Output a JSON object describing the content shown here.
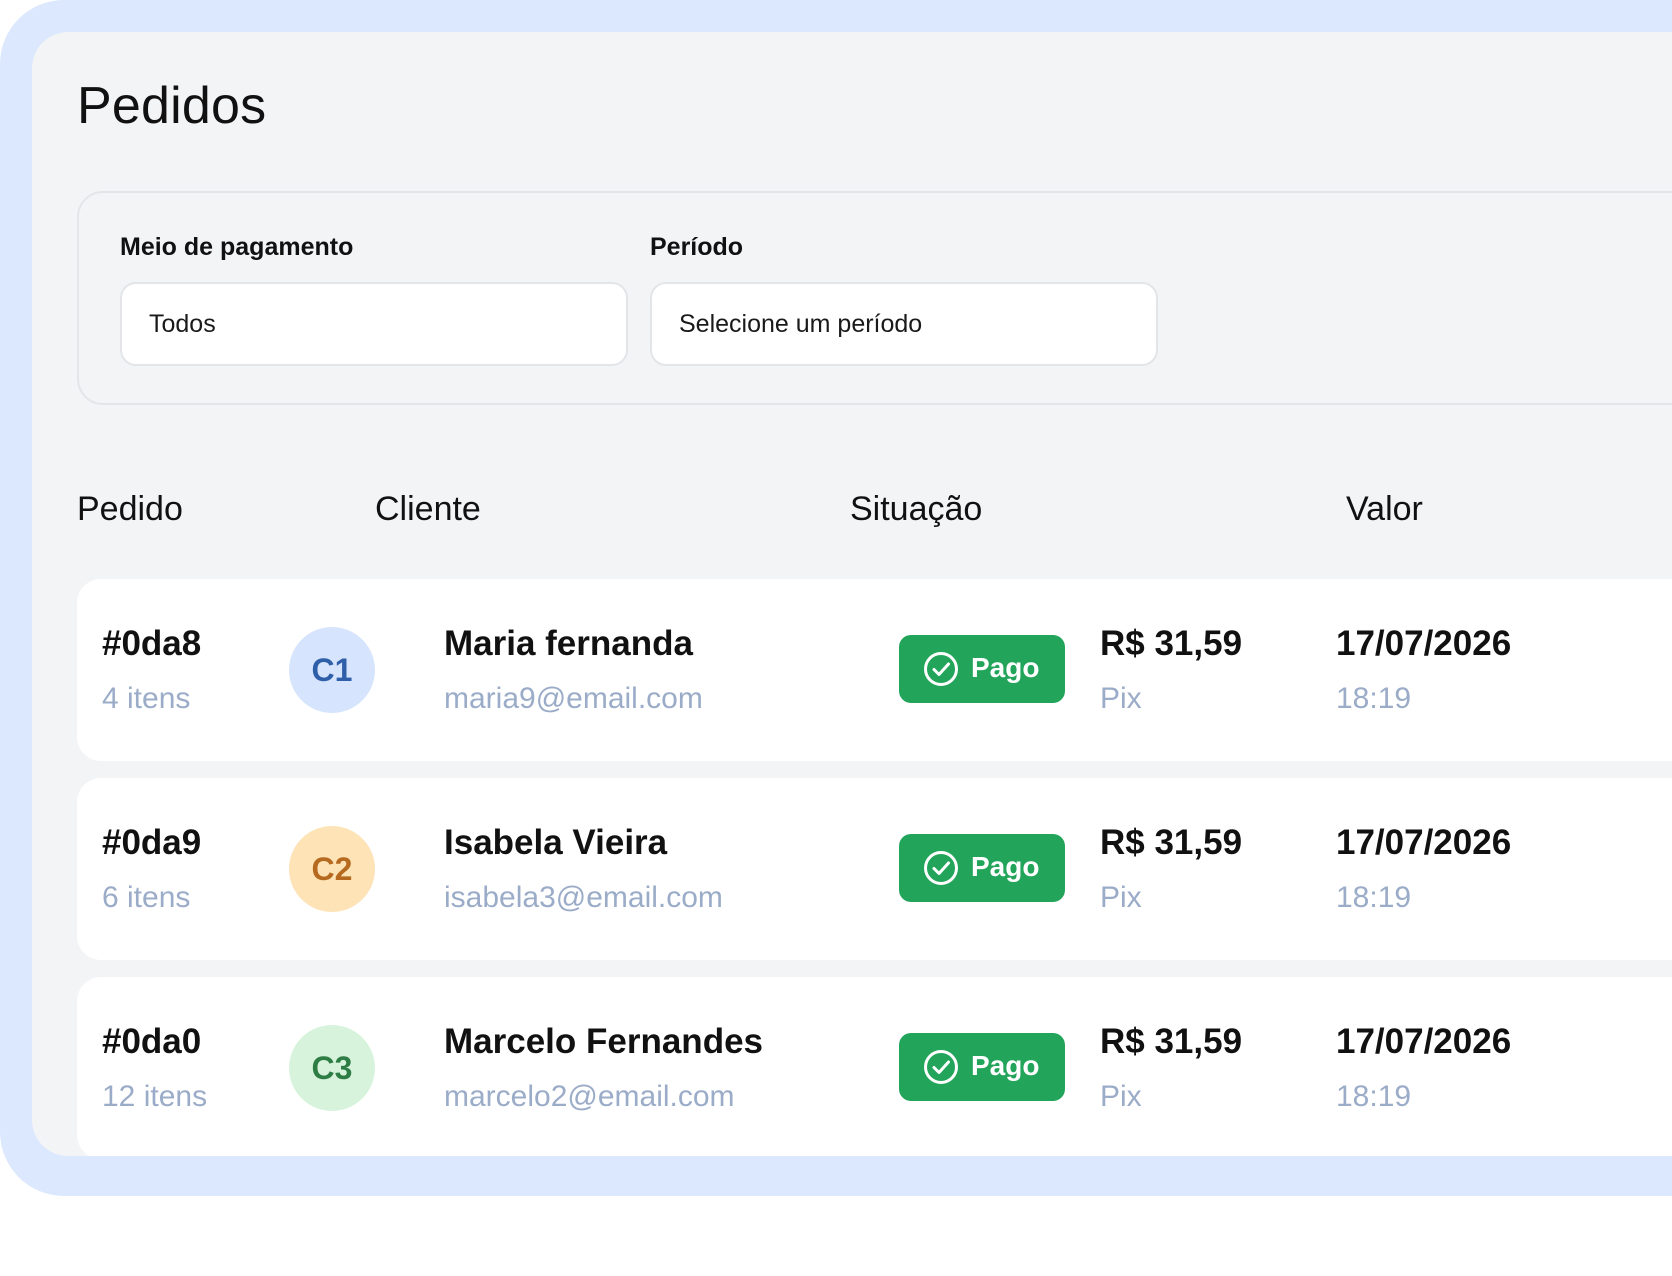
{
  "page": {
    "title": "Pedidos"
  },
  "filters": {
    "payment": {
      "label": "Meio de pagamento",
      "value": "Todos"
    },
    "period": {
      "label": "Período",
      "placeholder": "Selecione um período"
    }
  },
  "table": {
    "headers": [
      "Pedido",
      "Cliente",
      "Situação",
      "Valor"
    ],
    "rows": [
      {
        "order_id": "#0da8",
        "items": "4 itens",
        "avatar": "C1",
        "avatar_bg": "#d6e4fd",
        "avatar_fg": "#2f5fa8",
        "name": "Maria fernanda",
        "email": "maria9@email.com",
        "status": "Pago",
        "amount": "R$ 31,59",
        "method": "Pix",
        "date": "17/07/2026",
        "time": "18:19"
      },
      {
        "order_id": "#0da9",
        "items": "6 itens",
        "avatar": "C2",
        "avatar_bg": "#fde3b6",
        "avatar_fg": "#b56a1f",
        "name": "Isabela Vieira",
        "email": "isabela3@email.com",
        "status": "Pago",
        "amount": "R$ 31,59",
        "method": "Pix",
        "date": "17/07/2026",
        "time": "18:19"
      },
      {
        "order_id": "#0da0",
        "items": "12 itens",
        "avatar": "C3",
        "avatar_bg": "#d7f3dc",
        "avatar_fg": "#2e7d45",
        "name": "Marcelo Fernandes",
        "email": "marcelo2@email.com",
        "status": "Pago",
        "amount": "R$ 31,59",
        "method": "Pix",
        "date": "17/07/2026",
        "time": "18:19"
      }
    ]
  },
  "colors": {
    "frame": "#dbe8fd",
    "panel": "#f3f4f6",
    "status_paid": "#22a55a",
    "muted_text": "#9bacc8"
  },
  "icons": {
    "status": "check-circle-icon"
  }
}
